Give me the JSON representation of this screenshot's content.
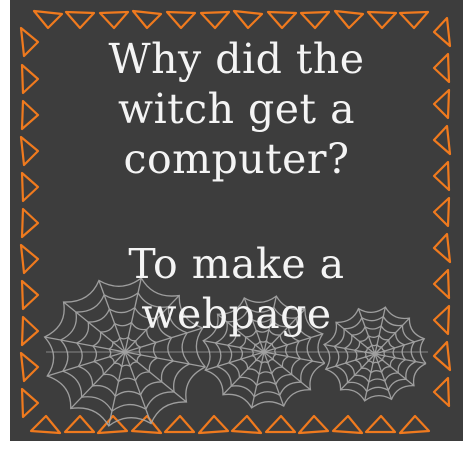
{
  "card": {
    "background": "#3d3d3d",
    "border_color": "#f07a1e",
    "web_color": "#a9a9a9",
    "text_color": "#f4f4f4"
  },
  "joke": {
    "question_lines": [
      "Why did the",
      "witch get a",
      "computer?"
    ],
    "answer_lines": [
      "To make a",
      "webpage"
    ]
  },
  "decorations": {
    "border_icon": "orange-triangle-outline",
    "web_icon": "spider-web"
  }
}
